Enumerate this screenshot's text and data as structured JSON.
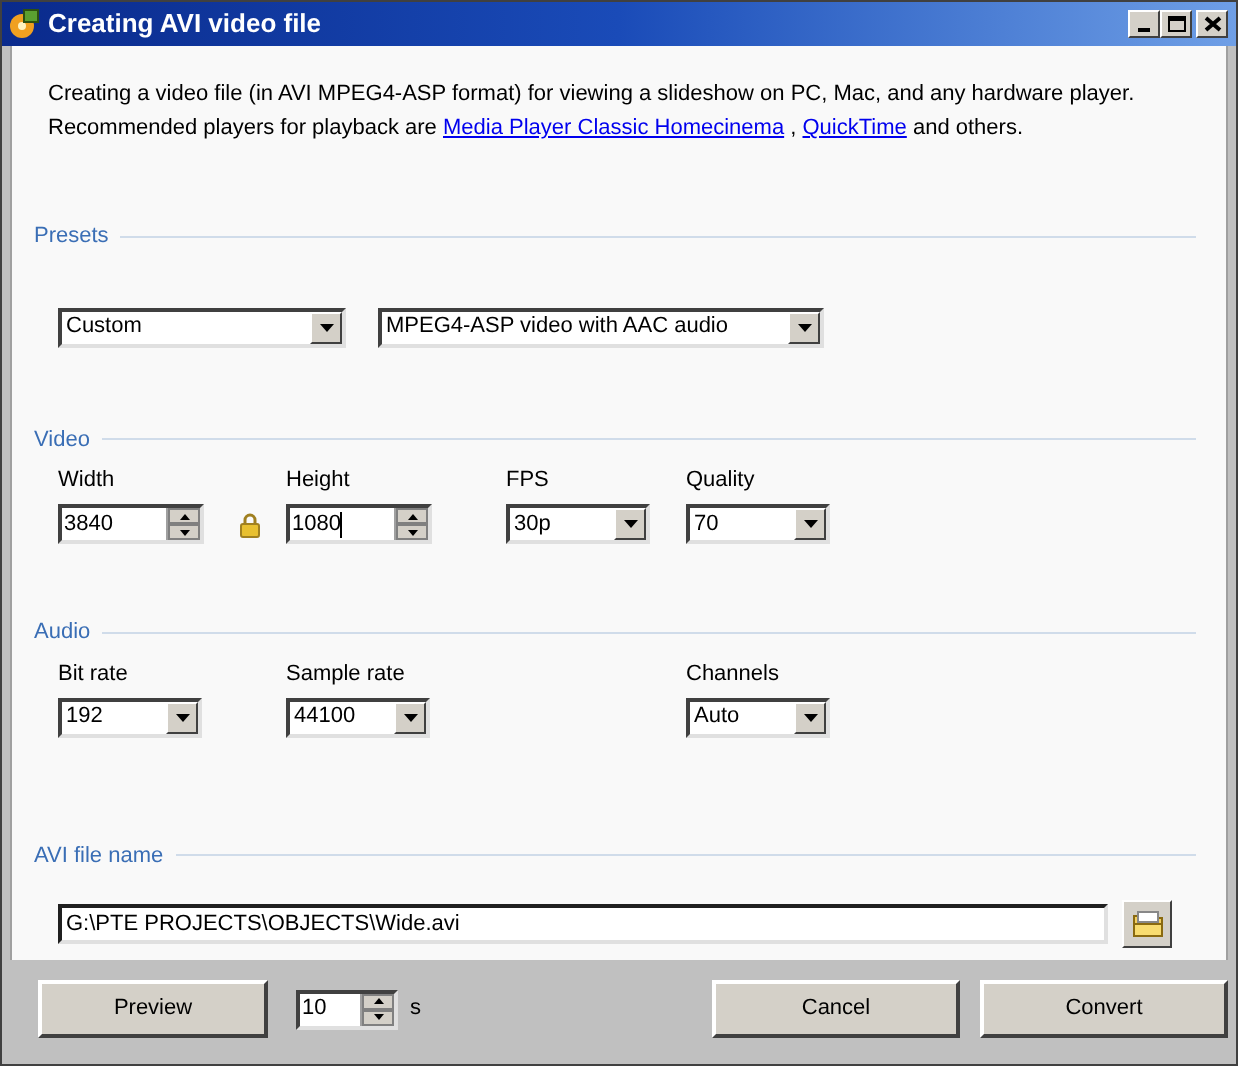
{
  "window": {
    "title": "Creating AVI video file"
  },
  "description": [
    [
      {
        "kind": "text",
        "text": "Creating a video file (in AVI MPEG4-ASP format) for viewing a slideshow on PC, Mac, and any hardware player."
      }
    ],
    [
      {
        "kind": "text",
        "text": "Recommended players for playback are"
      },
      {
        "kind": "link",
        "text": "Media Player Classic Homecinema"
      },
      {
        "kind": "text",
        "text": ","
      },
      {
        "kind": "link",
        "text": "QuickTime"
      },
      {
        "kind": "text",
        "text": "and others."
      }
    ]
  ],
  "presets": {
    "title": "Presets",
    "dropdowns": [
      {
        "value": "Custom"
      },
      {
        "value": "MPEG4-ASP video with AAC audio"
      }
    ]
  },
  "sections": [
    {
      "title": "Video",
      "fields": [
        {
          "label": "Width",
          "kind": "spin",
          "value": "3840",
          "focused": false,
          "aspect_lock": true
        },
        {
          "label": "Height",
          "kind": "spin",
          "value": "1080",
          "focused": true
        },
        {
          "label": "FPS",
          "kind": "dropdown",
          "value": "30p"
        },
        {
          "label": "Quality",
          "kind": "dropdown",
          "value": "70"
        }
      ]
    },
    {
      "title": "Audio",
      "fields": [
        {
          "label": "Bit rate",
          "kind": "dropdown",
          "value": "192"
        },
        {
          "label": "Sample rate",
          "kind": "dropdown",
          "value": "44100"
        },
        {
          "label": "Channels",
          "kind": "dropdown",
          "value": "Auto"
        }
      ]
    }
  ],
  "file": {
    "title": "AVI file name",
    "value": "G:\\PTE PROJECTS\\OBJECTS\\Wide.avi"
  },
  "footer": {
    "preview": "Preview",
    "duration": "10",
    "unit": "s",
    "buttons": [
      "Cancel",
      "Convert"
    ]
  }
}
